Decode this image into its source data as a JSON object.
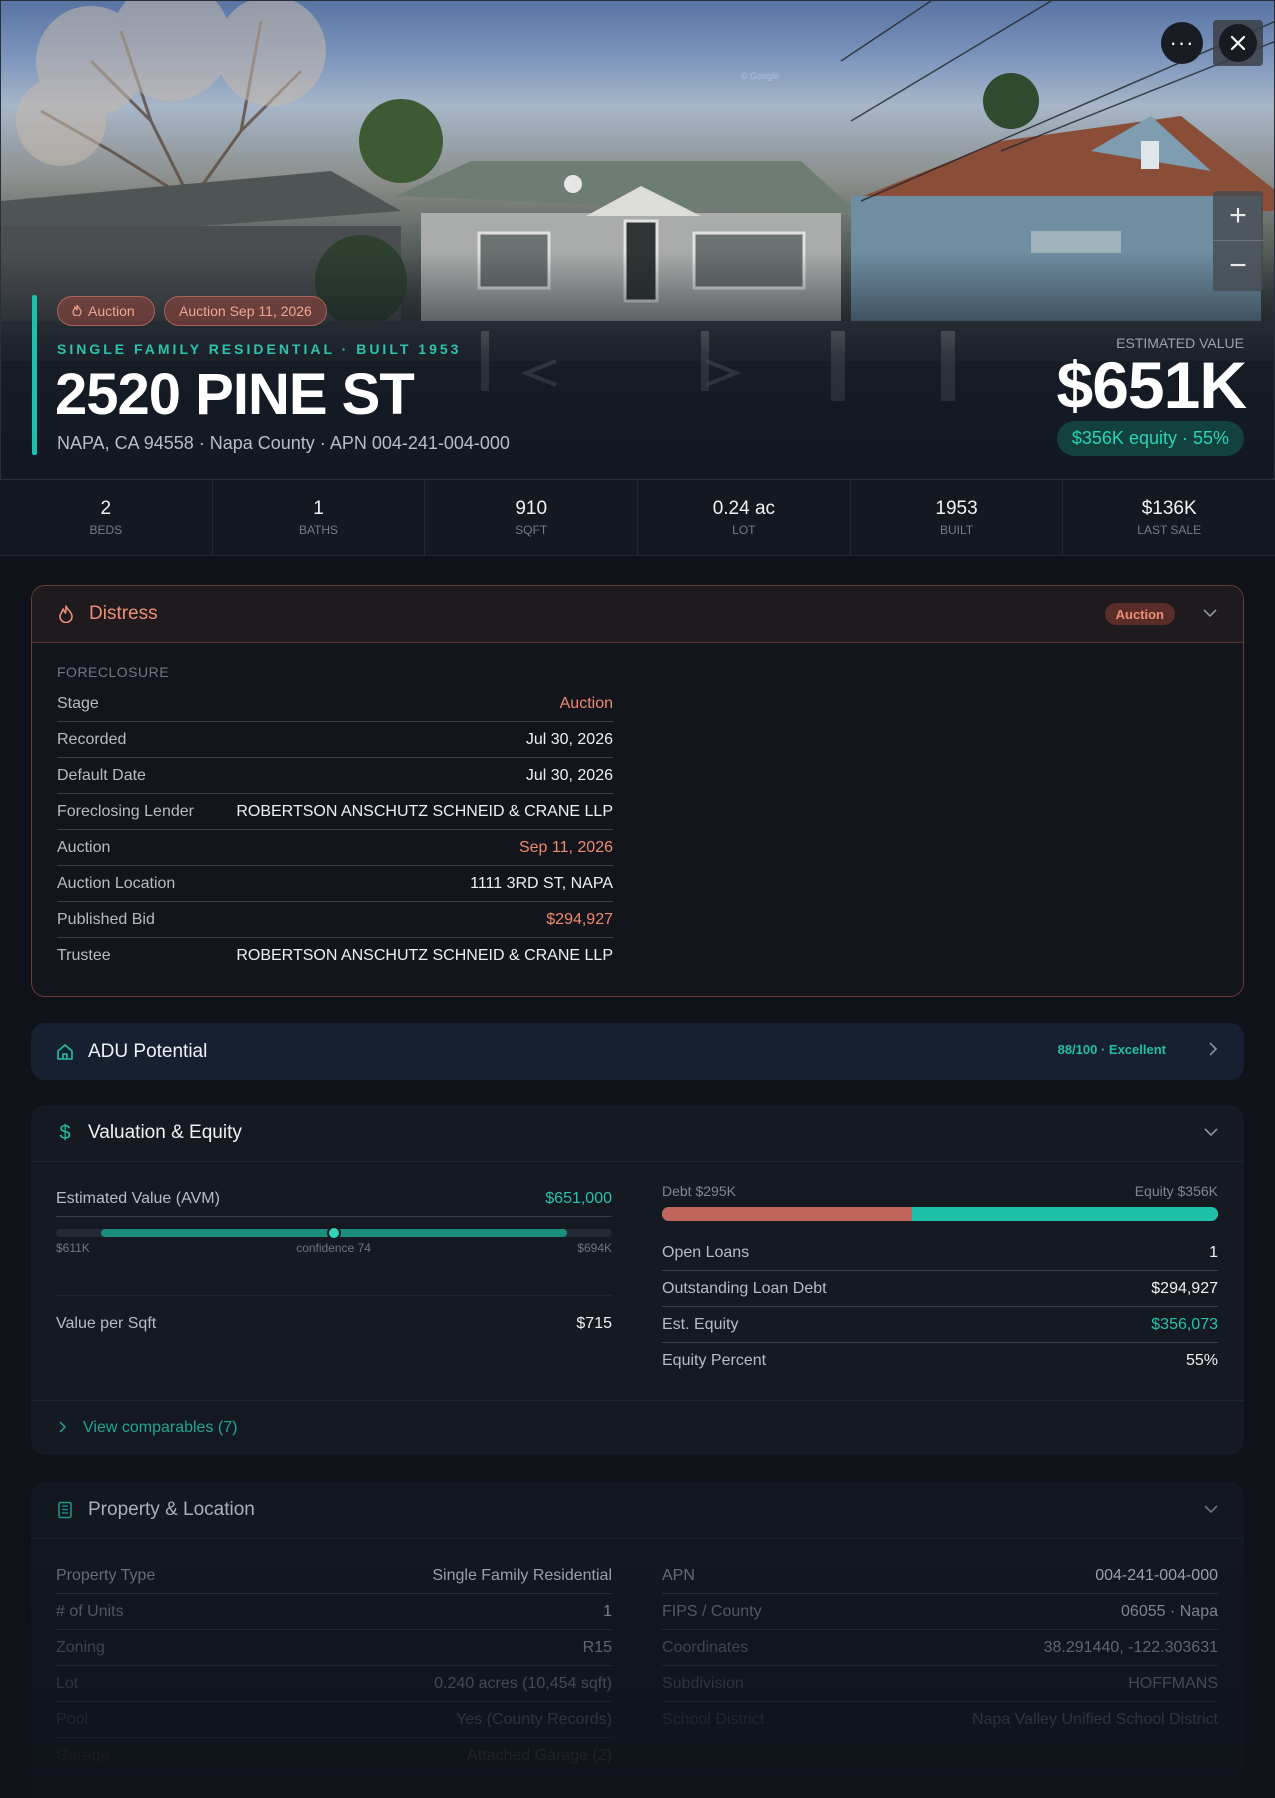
{
  "hero": {
    "badge_auction": "Auction",
    "badge_auction_date": "Auction Sep 11, 2026",
    "subtype": "SINGLE FAMILY RESIDENTIAL · BUILT 1953",
    "address": "2520 PINE ST",
    "location": "NAPA, CA 94558 · Napa County · APN 004-241-004-000",
    "estimated_value_label": "ESTIMATED VALUE",
    "estimated_value": "$651K",
    "equity_pill": "$356K equity · 55%",
    "more_glyph": "···",
    "zoom_in": "+",
    "zoom_out": "−",
    "watermark": "© Google"
  },
  "stats": [
    {
      "value": "2",
      "label": "BEDS"
    },
    {
      "value": "1",
      "label": "BATHS"
    },
    {
      "value": "910",
      "label": "SQFT"
    },
    {
      "value": "0.24 ac",
      "label": "LOT"
    },
    {
      "value": "1953",
      "label": "BUILT"
    },
    {
      "value": "$136K",
      "label": "LAST SALE"
    }
  ],
  "distress": {
    "title": "Distress",
    "badge": "Auction",
    "section": "FORECLOSURE",
    "rows": [
      {
        "k": "Stage",
        "v": "Auction"
      },
      {
        "k": "Recorded",
        "v": "Jul 30, 2026"
      },
      {
        "k": "Default Date",
        "v": "Jul 30, 2026"
      },
      {
        "k": "Foreclosing Lender",
        "v": "ROBERTSON ANSCHUTZ SCHNEID & CRANE LLP"
      },
      {
        "k": "Auction",
        "v": "Sep 11, 2026"
      },
      {
        "k": "Auction Location",
        "v": "1111 3RD ST, NAPA"
      },
      {
        "k": "Published Bid",
        "v": "$294,927"
      },
      {
        "k": "Trustee",
        "v": "ROBERTSON ANSCHUTZ SCHNEID & CRANE LLP"
      }
    ]
  },
  "adu": {
    "title": "ADU Potential",
    "score": "88/100 · Excellent"
  },
  "valuation": {
    "title": "Valuation & Equity",
    "avm_label": "Estimated Value (AVM)",
    "avm_value": "$651,000",
    "avm_low": "$611K",
    "avm_confidence": "confidence 74",
    "avm_high": "$694K",
    "avm_position": 0.5,
    "value_per_sqft_label": "Value per Sqft",
    "value_per_sqft": "$715",
    "debt_label": "Debt $295K",
    "equity_label": "Equity $356K",
    "debt_fraction": 0.45,
    "rows": [
      {
        "k": "Open Loans",
        "v": "1"
      },
      {
        "k": "Outstanding Loan Debt",
        "v": "$294,927"
      },
      {
        "k": "Est. Equity",
        "v": "$356,073"
      },
      {
        "k": "Equity Percent",
        "v": "55%"
      }
    ],
    "comparables": "View comparables (7)"
  },
  "property": {
    "title": "Property & Location",
    "left": [
      {
        "k": "Property Type",
        "v": "Single Family Residential"
      },
      {
        "k": "# of Units",
        "v": "1"
      },
      {
        "k": "Zoning",
        "v": "R15"
      },
      {
        "k": "Lot",
        "v": "0.240 acres (10,454 sqft)"
      },
      {
        "k": "Pool",
        "v": "Yes (County Records)"
      },
      {
        "k": "Garage",
        "v": "Attached Garage (2)"
      }
    ],
    "right": [
      {
        "k": "APN",
        "v": "004-241-004-000"
      },
      {
        "k": "FIPS / County",
        "v": "06055 · Napa"
      },
      {
        "k": "Coordinates",
        "v": "38.291440, -122.303631"
      },
      {
        "k": "Subdivision",
        "v": "HOFFMANS"
      },
      {
        "k": "School District",
        "v": "Napa Valley Unified School District"
      }
    ]
  },
  "colors": {
    "accent": "#1fbfaa",
    "distress": "#ee8d74",
    "background": "#0f1219"
  }
}
